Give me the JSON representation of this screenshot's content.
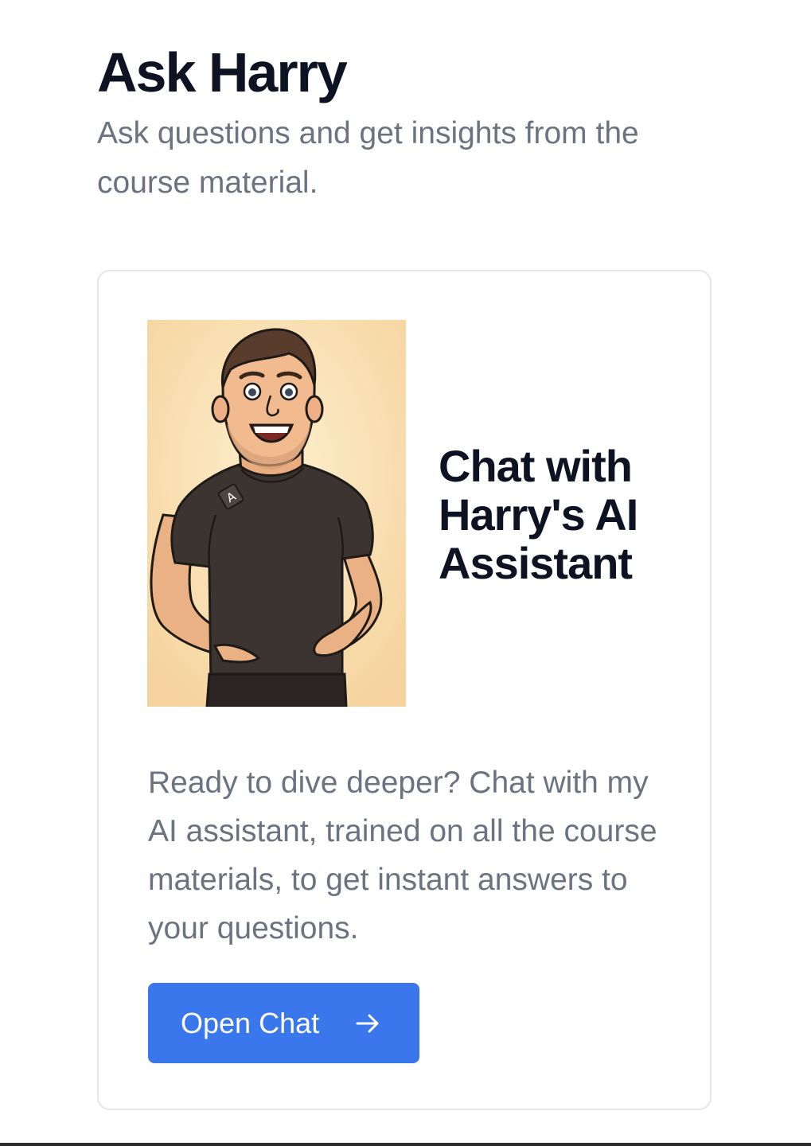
{
  "header": {
    "title": "Ask Harry",
    "subtitle": "Ask questions and get insights from the course material."
  },
  "card": {
    "avatar_icon": "harry-cartoon-avatar",
    "shirt_badge_letter": "A",
    "heading": "Chat with Harry's AI Assistant",
    "description": "Ready to dive deeper? Chat with my AI assistant, trained on all the course materials, to get instant answers to your questions.",
    "button_label": "Open Chat",
    "button_icon": "arrow-right-icon"
  },
  "colors": {
    "accent": "#3b77ec",
    "title": "#0d1322",
    "muted_text": "#6b7381",
    "card_border": "#e3e7ec",
    "avatar_background": "#f8d9a6",
    "shirt": "#3c3431"
  }
}
